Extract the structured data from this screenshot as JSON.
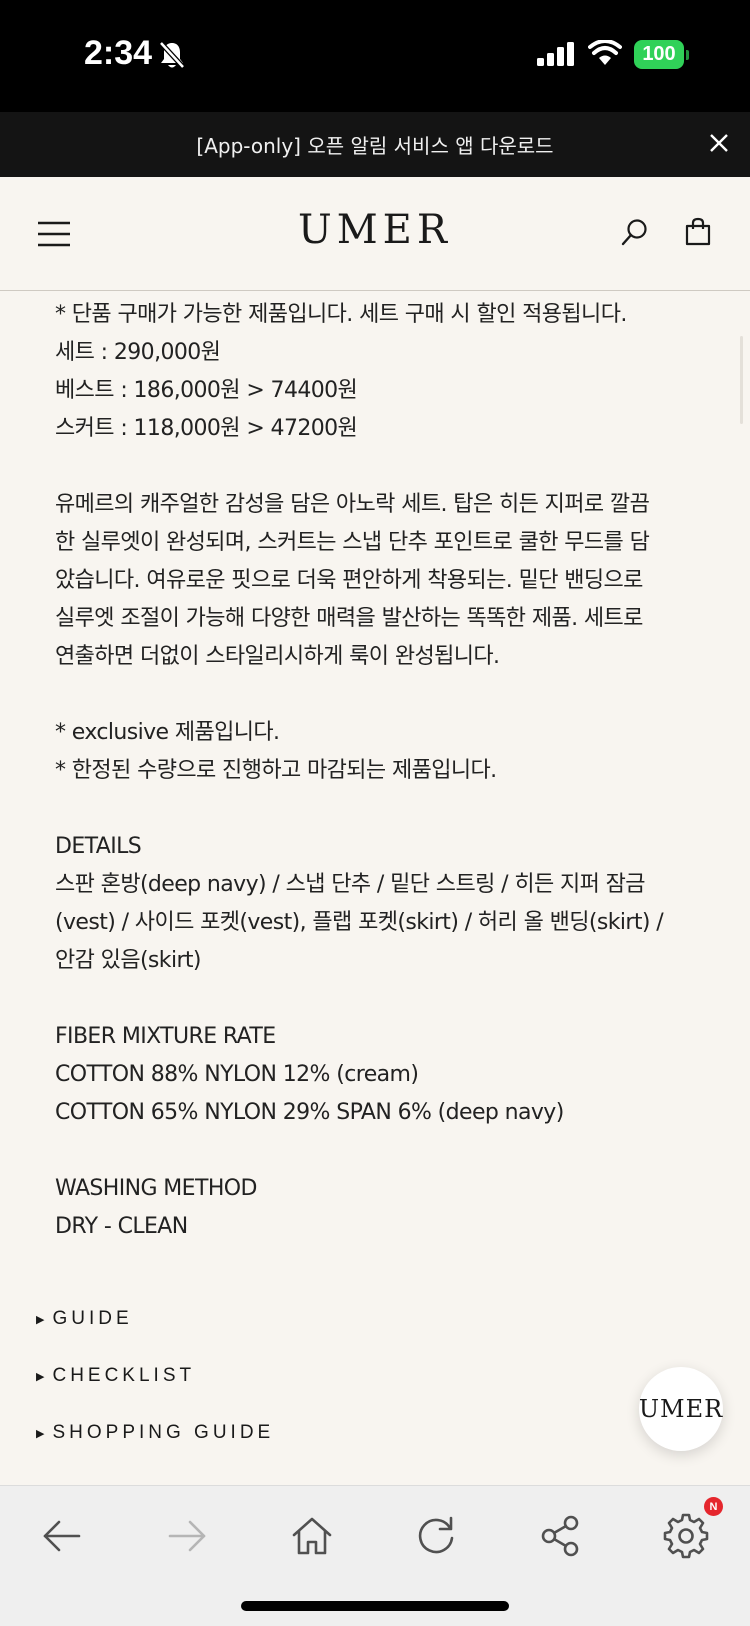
{
  "status_bar": {
    "time": "2:34",
    "battery": "100"
  },
  "promo_banner": {
    "text": "[App-only] 오픈 알림 서비스 앱 다운로드"
  },
  "header": {
    "logo": "UMER"
  },
  "description": {
    "lines": [
      "* 단품 구매가 가능한 제품입니다. 세트 구매 시 할인 적용됩니다.",
      "세트 : 290,000원",
      "베스트 : 186,000원 > 74400원",
      "스커트 : 118,000원 > 47200원",
      "",
      "유메르의 캐주얼한 감성을 담은 아노락 세트. 탑은 히든 지퍼로 깔끔",
      "한 실루엣이 완성되며, 스커트는 스냅 단추 포인트로 쿨한 무드를 담",
      "았습니다. 여유로운 핏으로 더욱 편안하게 착용되는. 밑단 밴딩으로",
      "실루엣 조절이 가능해 다양한 매력을 발산하는 똑똑한 제품. 세트로",
      "연출하면 더없이 스타일리시하게 룩이 완성됩니다.",
      "",
      "* exclusive 제품입니다.",
      "* 한정된 수량으로 진행하고 마감되는 제품입니다.",
      "",
      "DETAILS",
      "스판 혼방(deep navy) / 스냅 단추 / 밑단 스트링 / 히든 지퍼 잠금",
      "(vest) / 사이드 포켓(vest), 플랩 포켓(skirt) / 허리 올 밴딩(skirt) /",
      "안감 있음(skirt)",
      "",
      "FIBER MIXTURE RATE",
      "COTTON 88% NYLON 12% (cream)",
      "COTTON 65% NYLON 29% SPAN 6% (deep navy)",
      "",
      "WASHING METHOD",
      "DRY - CLEAN"
    ]
  },
  "accordion": [
    {
      "label": "GUIDE"
    },
    {
      "label": "CHECKLIST"
    },
    {
      "label": "SHOPPING GUIDE"
    }
  ],
  "floating_button": {
    "label": "UMER"
  },
  "toolbar": {
    "items": [
      "back-arrow-icon",
      "forward-arrow-icon",
      "home-icon",
      "reload-icon",
      "share-icon",
      "settings-icon"
    ],
    "settings_badge": "N",
    "colors": {
      "icon": "#505050",
      "disabled": "#b5b5b5",
      "badge": "#e5262d"
    }
  }
}
